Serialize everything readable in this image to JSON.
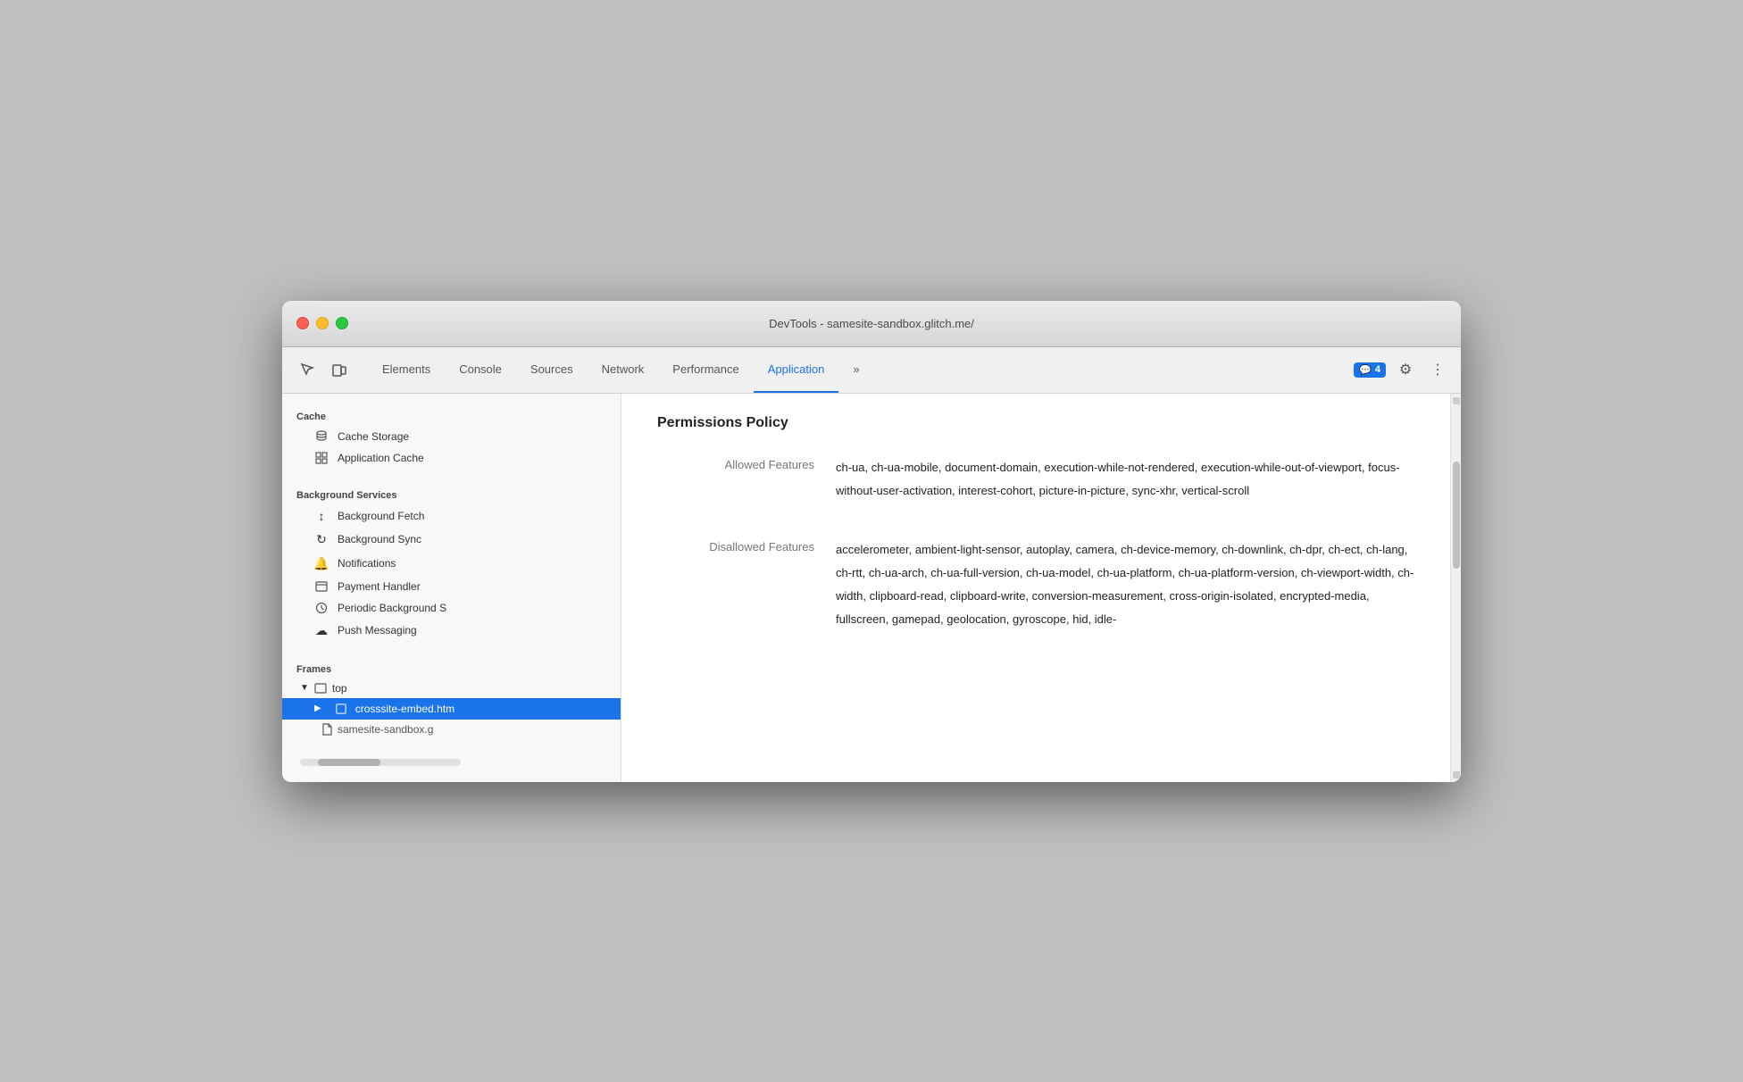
{
  "window": {
    "title": "DevTools - samesite-sandbox.glitch.me/"
  },
  "toolbar": {
    "tabs": [
      {
        "id": "elements",
        "label": "Elements",
        "active": false
      },
      {
        "id": "console",
        "label": "Console",
        "active": false
      },
      {
        "id": "sources",
        "label": "Sources",
        "active": false
      },
      {
        "id": "network",
        "label": "Network",
        "active": false
      },
      {
        "id": "performance",
        "label": "Performance",
        "active": false
      },
      {
        "id": "application",
        "label": "Application",
        "active": true
      }
    ],
    "more_tabs": "»",
    "notification_icon": "💬",
    "notification_count": "4"
  },
  "sidebar": {
    "cache_section": "Cache",
    "cache_items": [
      {
        "id": "cache-storage",
        "label": "Cache Storage",
        "icon": "🗄"
      },
      {
        "id": "application-cache",
        "label": "Application Cache",
        "icon": "▦"
      }
    ],
    "background_section": "Background Services",
    "background_items": [
      {
        "id": "background-fetch",
        "label": "Background Fetch",
        "icon": "↕"
      },
      {
        "id": "background-sync",
        "label": "Background Sync",
        "icon": "↻"
      },
      {
        "id": "notifications",
        "label": "Notifications",
        "icon": "🔔"
      },
      {
        "id": "payment-handler",
        "label": "Payment Handler",
        "icon": "💳"
      },
      {
        "id": "periodic-background",
        "label": "Periodic Background S",
        "icon": "🕐"
      },
      {
        "id": "push-messaging",
        "label": "Push Messaging",
        "icon": "☁"
      }
    ],
    "frames_section": "Frames",
    "frames": {
      "top_label": "top",
      "children": [
        {
          "id": "crosssite-embed",
          "label": "crosssite-embed.htm",
          "active": true
        },
        {
          "id": "samesite-sandbox",
          "label": "samesite-sandbox.g",
          "active": false
        }
      ]
    }
  },
  "content": {
    "title": "Permissions Policy",
    "allowed_label": "Allowed Features",
    "allowed_value": "ch-ua, ch-ua-mobile, document-domain, execution-while-not-rendered, execution-while-out-of-viewport, focus-without-user-activation, interest-cohort, picture-in-picture, sync-xhr, vertical-scroll",
    "disallowed_label": "Disallowed Features",
    "disallowed_value": "accelerometer, ambient-light-sensor, autoplay, camera, ch-device-memory, ch-downlink, ch-dpr, ch-ect, ch-lang, ch-rtt, ch-ua-arch, ch-ua-full-version, ch-ua-model, ch-ua-platform, ch-ua-platform-version, ch-viewport-width, ch-width, clipboard-read, clipboard-write, conversion-measurement, cross-origin-isolated, encrypted-media, fullscreen, gamepad, geolocation, gyroscope, hid, idle-"
  }
}
